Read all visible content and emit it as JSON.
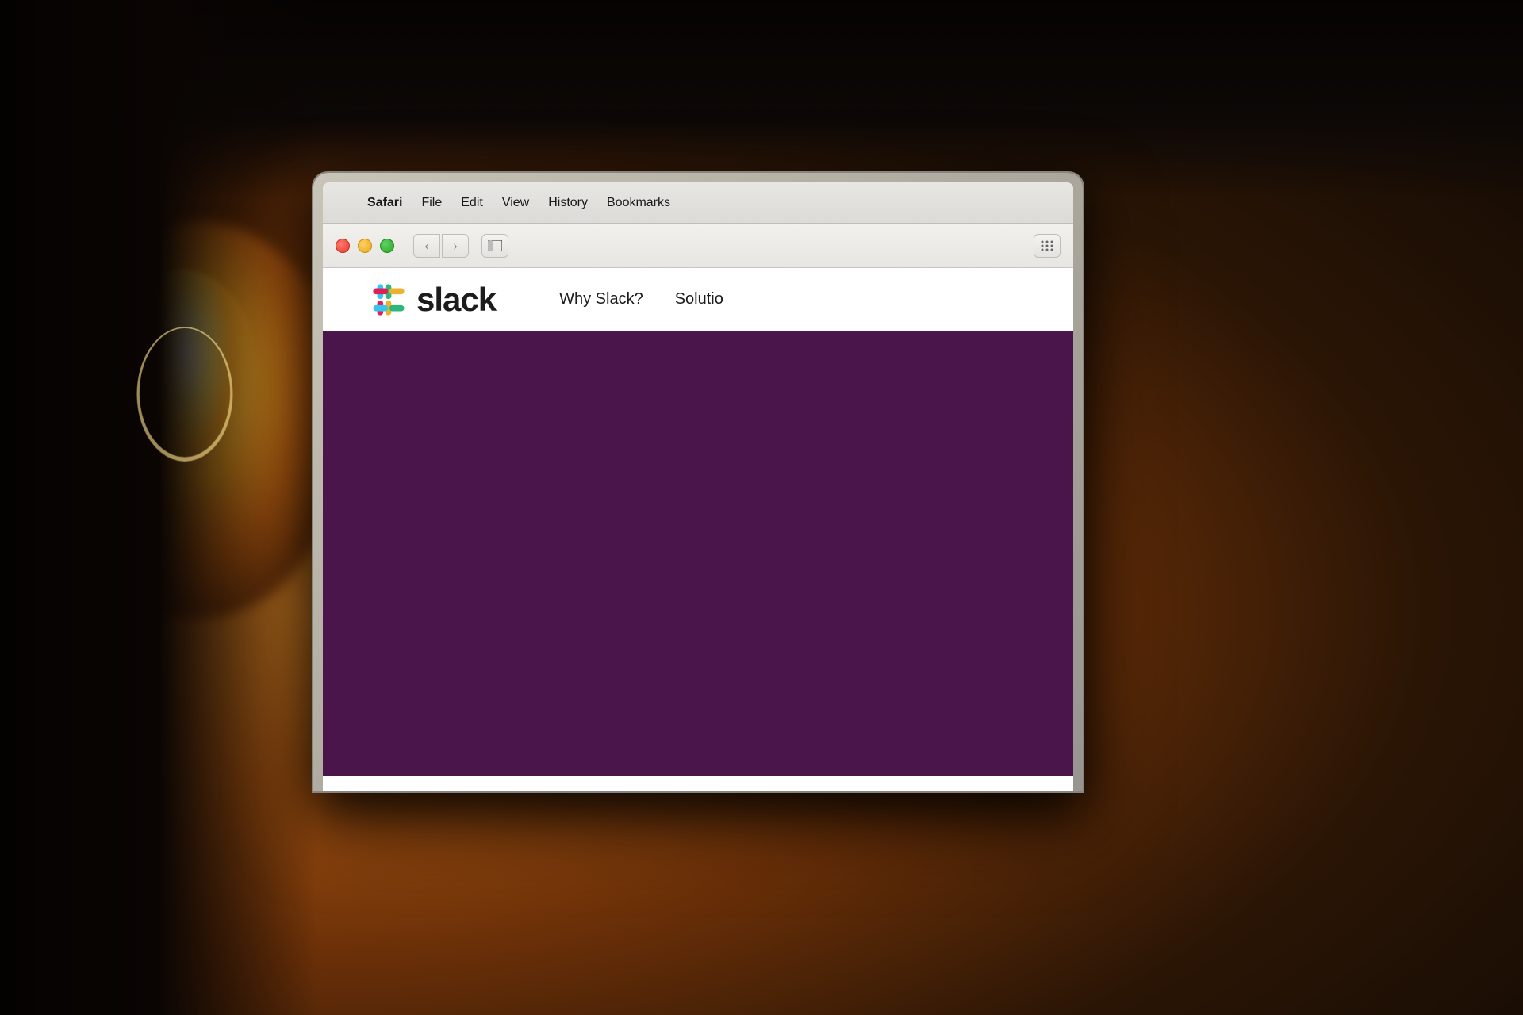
{
  "background": {
    "description": "Dark room with warm incandescent light bulb glow"
  },
  "macbook": {
    "screen": {
      "menu_bar": {
        "apple_symbol": "",
        "items": [
          {
            "label": "Safari",
            "active": true
          },
          {
            "label": "File",
            "active": false
          },
          {
            "label": "Edit",
            "active": false
          },
          {
            "label": "View",
            "active": false
          },
          {
            "label": "History",
            "active": false
          },
          {
            "label": "Bookmarks",
            "active": false
          }
        ]
      },
      "toolbar": {
        "back_button": "‹",
        "forward_button": "›",
        "sidebar_icon": "⊡",
        "tabs_icon": "⠿"
      },
      "webpage": {
        "slack_nav": {
          "logo_text": "slack",
          "nav_links": [
            "Why Slack?",
            "Solutio"
          ]
        },
        "hero": {
          "background_color": "#4a154b"
        }
      }
    }
  }
}
